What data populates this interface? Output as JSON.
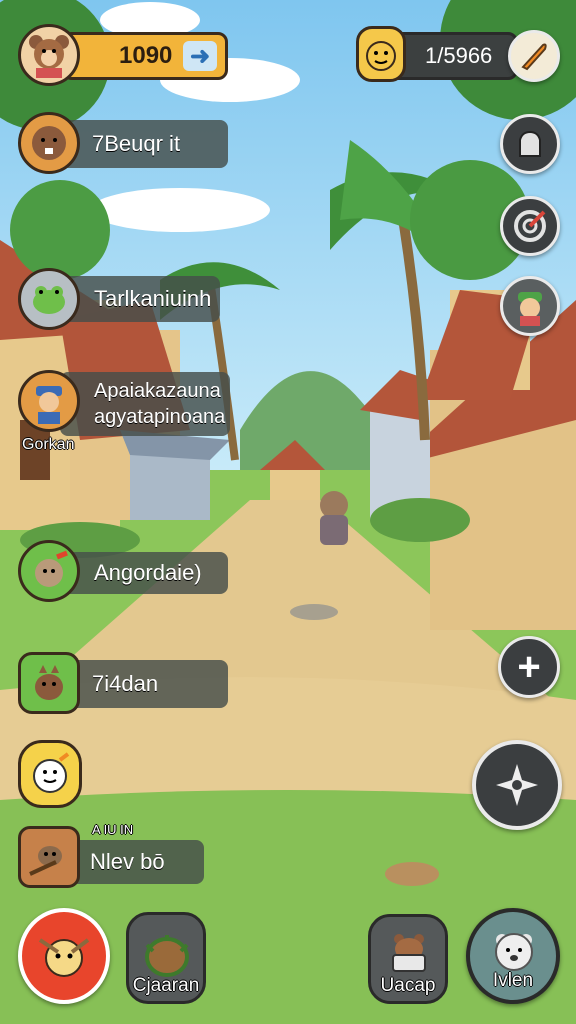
{
  "hud": {
    "coins_value": "1090",
    "gems_value": "1/5966"
  },
  "left_menu": [
    {
      "label": "7Beuqr it",
      "icon": "beaver-icon"
    },
    {
      "label": "Tarlkaniuinh",
      "icon": "frog-icon"
    },
    {
      "label_line1": "Apaiakazauna",
      "label_line2": "agyatapinoana",
      "sub": "Gorkan",
      "icon": "farmer-icon"
    },
    {
      "label": "Angordaie)",
      "icon": "cookie-icon"
    },
    {
      "label": "7i4dan",
      "icon": "squirrel-icon"
    },
    {
      "label": "",
      "icon": "snowman-icon"
    },
    {
      "label": "Nlev bō",
      "small": "A IU IN",
      "icon": "raccoon-icon"
    }
  ],
  "bottom_bar": {
    "main_label": "",
    "gather_label": "Cjaaran",
    "pack_label": "Uacap",
    "pet_label": "Ivlen"
  },
  "colors": {
    "coin_bar": "#f2b43a",
    "pill": "#464e4a",
    "main_button": "#e8452c"
  }
}
